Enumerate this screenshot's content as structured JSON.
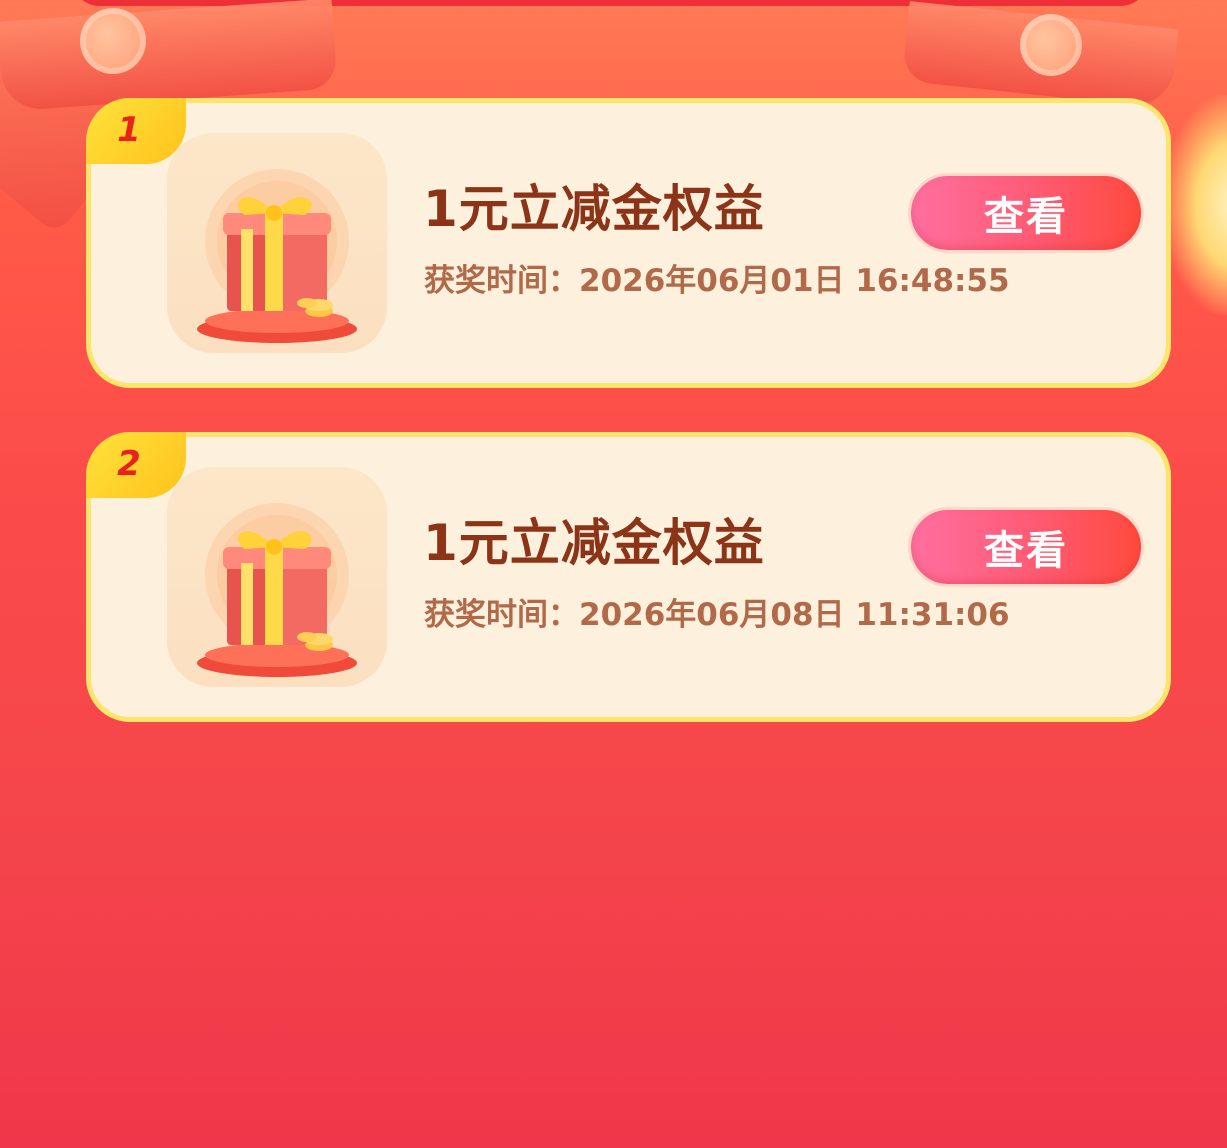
{
  "colors": {
    "background_top": "#ff7a55",
    "background_bottom": "#f0364a",
    "card_bg": "#fdf1de",
    "card_border": "#fbe56a",
    "rank_tag": "#ffc21a",
    "rank_text": "#e8221b",
    "title_text": "#8b3418",
    "time_text": "#b06a4a",
    "button_gradient_start": "#ff6fa0",
    "button_gradient_end": "#ff4a3d"
  },
  "prizes": [
    {
      "rank": "1",
      "icon": "gift-box-icon",
      "title": "1元立减金权益",
      "award_time": "获奖时间：2026年06月01日 16:48:55",
      "button_label": "查看"
    },
    {
      "rank": "2",
      "icon": "gift-box-icon",
      "title": "1元立减金权益",
      "award_time": "获奖时间：2026年06月08日 11:31:06",
      "button_label": "查看"
    }
  ]
}
